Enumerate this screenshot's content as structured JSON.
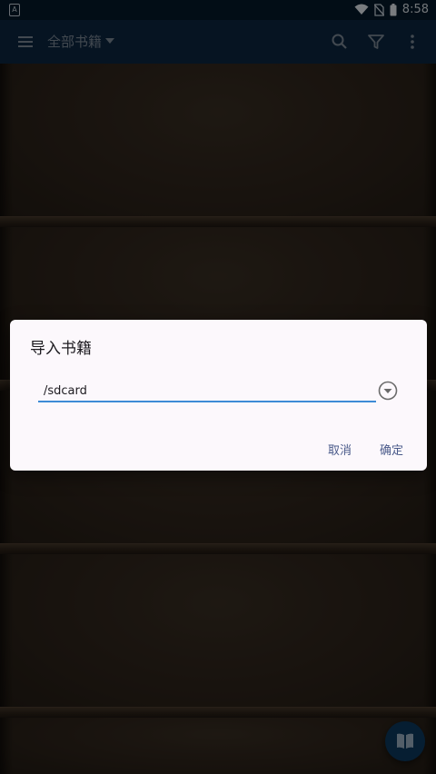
{
  "status_bar": {
    "time": "8:58",
    "left_icon": "a-icon",
    "icons": [
      "wifi-icon",
      "no-sim-icon",
      "battery-icon"
    ]
  },
  "app_bar": {
    "title": "全部书籍",
    "icons": [
      "menu-icon",
      "search-icon",
      "filter-icon",
      "more-icon"
    ]
  },
  "dialog": {
    "title": "导入书籍",
    "path_value": "/sdcard",
    "cancel_label": "取消",
    "confirm_label": "确定"
  },
  "fab": {
    "icon": "book-icon"
  },
  "colors": {
    "status_bar": "#04192b",
    "app_bar": "#0c2741",
    "accent": "#3d8bd6",
    "dialog_bg": "#fcf8fc",
    "button_text": "#4a5a8a"
  }
}
